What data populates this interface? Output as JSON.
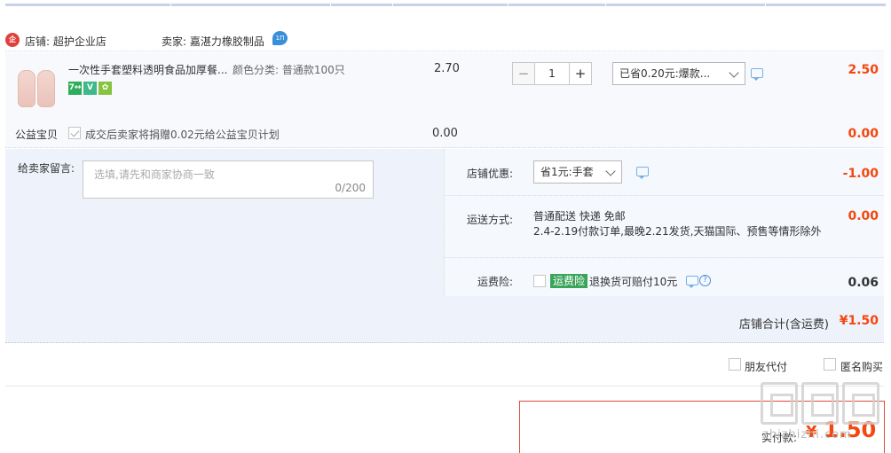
{
  "colors": {
    "accent": "#f5470f",
    "border_blue": "#c7d3ea",
    "panel_bg": "#eef3fb",
    "pay_border": "#e24a3c",
    "insurance_green": "#3aa45a"
  },
  "shop": {
    "icon_text": "企",
    "store_name": "店铺: 超护企业店",
    "seller": "卖家: 嘉湛力橡胶制品",
    "ww_icon_text": "1Π"
  },
  "item": {
    "title": "一次性手套塑料透明食品加厚餐...",
    "sku": "颜色分类: 普通款100只",
    "badges": [
      "7↔",
      "V",
      "✿"
    ],
    "unit_price": "2.70",
    "quantity": "1",
    "qty_minus": "−",
    "qty_plus": "+",
    "promo_selected": "已省0.20元:爆款...",
    "total": "2.50"
  },
  "charity": {
    "label": "公益宝贝",
    "text": "成交后卖家将捐赠0.02元给公益宝贝计划",
    "price": "0.00",
    "total": "0.00"
  },
  "message": {
    "label": "给卖家留言:",
    "placeholder": "选填,请先和商家协商一致",
    "count": "0/200"
  },
  "store_discount": {
    "label": "店铺优惠:",
    "selected": "省1元:手套",
    "value": "-1.00"
  },
  "shipping": {
    "label": "运送方式:",
    "line1": "普通配送 快递 免邮",
    "line2": "2.4-2.19付款订单,最晚2.21发货,天猫国际、预售等情形除外",
    "value": "0.00"
  },
  "insurance": {
    "label": "运费险:",
    "badge": "运费险",
    "text": "退换货可赔付10元",
    "help": "?",
    "value": "0.06"
  },
  "subtotal": {
    "label": "店铺合计(含运费)",
    "value": "¥1.50"
  },
  "options": {
    "friend_pay": "朋友代付",
    "anonymous": "匿名购买"
  },
  "payment": {
    "label": "实付款:",
    "currency": "¥",
    "value": "1.50"
  },
  "watermark": {
    "text": "zhizhizhi.com"
  }
}
